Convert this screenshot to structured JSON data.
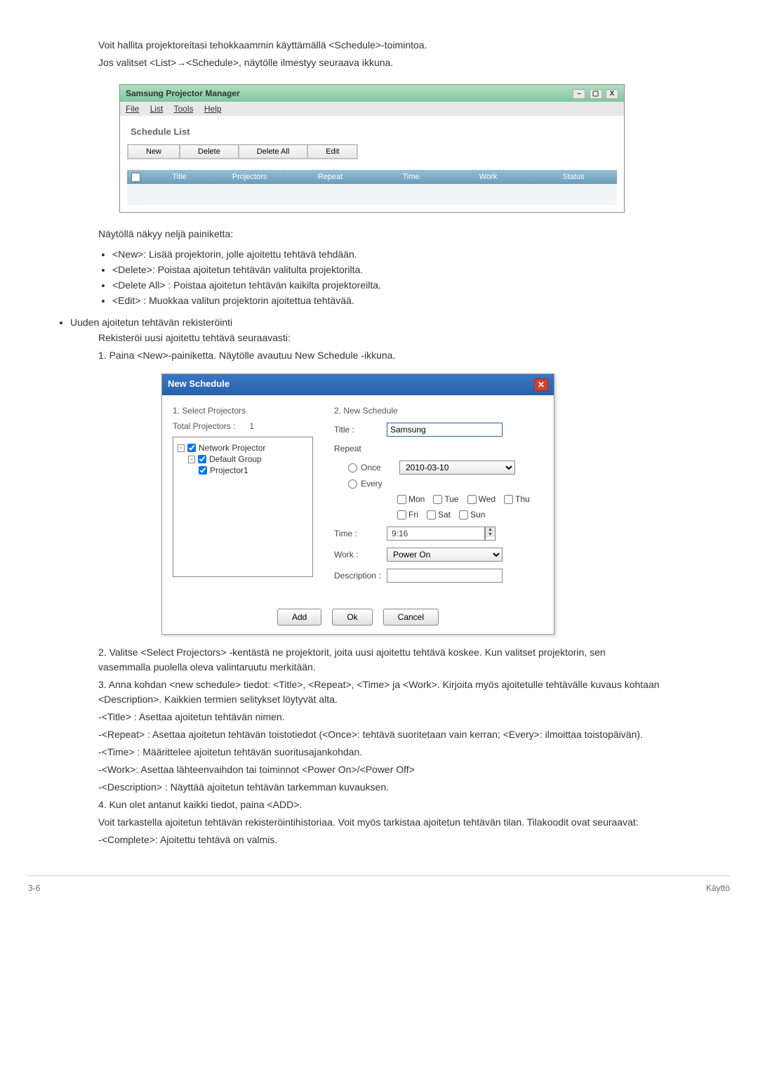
{
  "intro": {
    "line1": "Voit hallita projektoreitasi tehokkaammin käyttämällä <Schedule>-toimintoa.",
    "line2": "Jos valitset <List>→<Schedule>, näytölle ilmestyy seuraava ikkuna."
  },
  "window1": {
    "title": "Samsung Projector Manager",
    "ctrl_min": "–",
    "ctrl_max": "▢",
    "ctrl_close": "X",
    "menu": {
      "file": "File",
      "list": "List",
      "tools": "Tools",
      "help": "Help"
    },
    "section_title": "Schedule List",
    "toolbar": {
      "new": "New",
      "delete": "Delete",
      "delete_all": "Delete All",
      "edit": "Edit"
    },
    "columns": {
      "title": "Title",
      "projectors": "Projectors",
      "repeat": "Repeat",
      "time": "Time",
      "work": "Work",
      "status": "Status"
    }
  },
  "buttons_intro": "Näytöllä näkyy neljä painiketta:",
  "buttons": [
    "<New>: Lisää projektorin, jolle ajoitettu tehtävä tehdään.",
    "<Delete>: Poistaa ajoitetun tehtävän valitulta projektorilta.",
    "<Delete All> : Poistaa ajoitetun tehtävän kaikilta projektoreilta.",
    "<Edit> : Muokkaa valitun projektorin ajoitettua tehtävää."
  ],
  "register": {
    "heading": "Uuden ajoitetun tehtävän rekisteröinti",
    "sub": "Rekisteröi uusi ajoitettu tehtävä seuraavasti:",
    "step1": "1. Paina <New>-painiketta. Näytölle avautuu New Schedule -ikkuna."
  },
  "dialog": {
    "title": "New Schedule",
    "left_label": "1. Select Projectors",
    "total": "Total Projectors :",
    "total_count": "1",
    "tree": {
      "root": "Network Projector",
      "group": "Default Group",
      "leaf": "Projector1"
    },
    "right_label": "2. New Schedule",
    "title_label": "Title :",
    "title_value": "Samsung",
    "repeat_label": "Repeat",
    "once": "Once",
    "every": "Every",
    "once_date": "2010-03-10",
    "days": {
      "mon": "Mon",
      "tue": "Tue",
      "wed": "Wed",
      "thu": "Thu",
      "fri": "Fri",
      "sat": "Sat",
      "sun": "Sun"
    },
    "time_label": "Time :",
    "time_value": "9:16",
    "work_label": "Work :",
    "work_value": "Power On",
    "desc_label": "Description :",
    "buttons": {
      "add": "Add",
      "ok": "Ok",
      "cancel": "Cancel"
    }
  },
  "post": {
    "step2": "2. Valitse <Select Projectors> -kentästä ne projektorit, joita uusi ajoitettu tehtävä koskee. Kun valitset projektorin, sen vasemmalla puolella oleva valintaruutu merkitään.",
    "step3": "3. Anna kohdan <new schedule> tiedot: <Title>, <Repeat>, <Time> ja <Work>. Kirjoita myös ajoitetulle tehtävälle kuvaus kohtaan <Description>. Kaikkien termien selitykset löytyvät alta.",
    "desc_title": "-<Title> : Asettaa ajoitetun tehtävän nimen.",
    "desc_repeat": "-<Repeat> : Asettaa ajoitetun tehtävän toistotiedot (<Once>: tehtävä suoritetaan vain kerran; <Every>: ilmoittaa toistopäivän).",
    "desc_time": "-<Time> : Määrittelee ajoitetun tehtävän suoritusajankohdan.",
    "desc_work": "-<Work>: Asettaa lähteenvaihdon tai toiminnot <Power On>/<Power Off>",
    "desc_desc": "-<Description> : Näyttää ajoitetun tehtävän tarkemman kuvauksen.",
    "step4": "4. Kun olet antanut kaikki tiedot, paina <ADD>.",
    "history": "Voit tarkastella ajoitetun tehtävän rekisteröintihistoriaa. Voit myös tarkistaa ajoitetun tehtävän tilan. Tilakoodit ovat seuraavat:",
    "complete": "-<Complete>: Ajoitettu tehtävä on valmis."
  },
  "footer": {
    "left": "3-6",
    "right": "Käyttö"
  }
}
